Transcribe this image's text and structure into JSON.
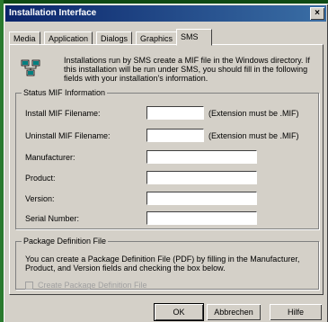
{
  "window": {
    "title": "Installation Interface",
    "close_glyph": "×"
  },
  "tabs": [
    {
      "label": "Media"
    },
    {
      "label": "Application"
    },
    {
      "label": "Dialogs"
    },
    {
      "label": "Graphics"
    },
    {
      "label": "SMS",
      "active": true
    }
  ],
  "intro": {
    "icon": "network-computers-icon",
    "text": "Installations run by SMS create a MIF file in the Windows directory. If this installation will be run under SMS, you should fill in the following fields with your installation's information."
  },
  "status_mif": {
    "title": "Status MIF Information",
    "install_label": "Install MIF Filename:",
    "install_value": "",
    "install_note": "(Extension must be .MIF)",
    "uninstall_label": "Uninstall MIF Filename:",
    "uninstall_value": "",
    "uninstall_note": "(Extension must be .MIF)",
    "manufacturer_label": "Manufacturer:",
    "manufacturer_value": "",
    "product_label": "Product:",
    "product_value": "",
    "version_label": "Version:",
    "version_value": "",
    "serial_label": "Serial Number:",
    "serial_value": ""
  },
  "package": {
    "title": "Package Definition File",
    "text": "You can create a Package Definition File (PDF) by filling in the Manufacturer, Product, and Version fields and checking the box below.",
    "checkbox_label": "Create Package Definition File",
    "checked": false,
    "enabled": false
  },
  "buttons": {
    "ok": "OK",
    "cancel": "Abbrechen",
    "help": "Hilfe"
  }
}
